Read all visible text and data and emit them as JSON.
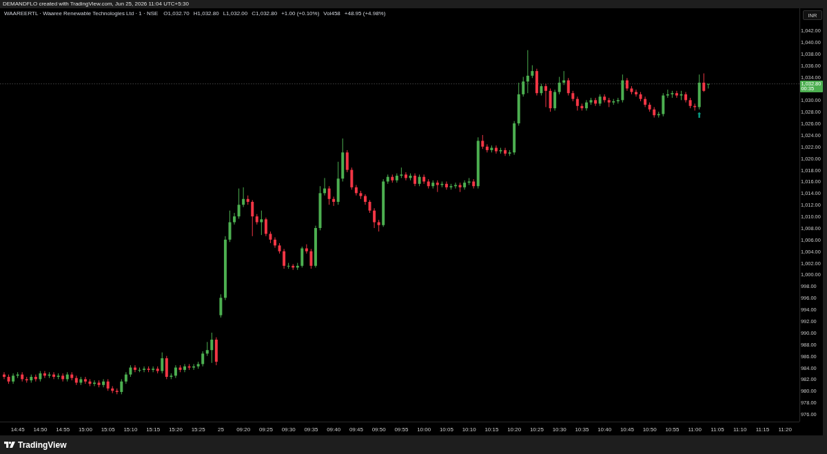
{
  "header": {
    "text": "DEMANDFLO created with TradingView.com, Jun 25, 2026 11:04 UTC+5:30"
  },
  "legend": {
    "symbol": "WAAREERTL · Waaree Renewable Technologies Ltd · 1 · NSE",
    "items": [
      "O1,032.70",
      "H1,032.80",
      "L1,032.00",
      "C1,032.80",
      "+1.00 (+0.10%)",
      "Vol458",
      "+48.95 (+4.98%)"
    ]
  },
  "currency_button": "INR",
  "price_tag": {
    "countdown": "00:35"
  },
  "chart_data": {
    "type": "candlestick",
    "ylim": [
      974.7,
      1045.8
    ],
    "ref_lines": [
      {
        "axis": "y",
        "value": 1032.8,
        "label": "1,032.80"
      }
    ],
    "annotations": [
      "⬆"
    ],
    "categories": [
      null,
      null,
      null,
      "14:45",
      null,
      null,
      null,
      null,
      "14:50",
      null,
      null,
      null,
      null,
      "14:55",
      null,
      null,
      null,
      null,
      "15:00",
      null,
      null,
      null,
      null,
      "15:05",
      null,
      null,
      null,
      null,
      "15:10",
      null,
      null,
      null,
      null,
      "15:15",
      null,
      null,
      null,
      null,
      "15:20",
      null,
      null,
      null,
      null,
      "15:25",
      null,
      null,
      null,
      null,
      "25",
      null,
      null,
      null,
      null,
      "09:20",
      null,
      null,
      null,
      null,
      "09:25",
      null,
      null,
      null,
      null,
      "09:30",
      null,
      null,
      null,
      null,
      "09:35",
      null,
      null,
      null,
      null,
      "09:40",
      null,
      null,
      null,
      null,
      "09:45",
      null,
      null,
      null,
      null,
      "09:50",
      null,
      null,
      null,
      null,
      "09:55",
      null,
      null,
      null,
      null,
      "10:00",
      null,
      null,
      null,
      null,
      "10:05",
      null,
      null,
      null,
      null,
      "10:10",
      null,
      null,
      null,
      null,
      "10:15",
      null,
      null,
      null,
      null,
      "10:20",
      null,
      null,
      null,
      null,
      "10:25",
      null,
      null,
      null,
      null,
      "10:30",
      null,
      null,
      null,
      null,
      "10:35",
      null,
      null,
      null,
      null,
      "10:40",
      null,
      null,
      null,
      null,
      "10:45",
      null,
      null,
      null,
      null,
      "10:50",
      null,
      null,
      null,
      null,
      "10:55",
      null,
      null,
      null,
      null,
      "11:00",
      null,
      null,
      null,
      null,
      "11:05",
      null,
      null,
      null,
      null,
      "11:10",
      null,
      null,
      null,
      null,
      "11:15",
      null,
      null,
      null,
      null,
      "11:20",
      null,
      null
    ],
    "ohlc": [
      [
        982.8,
        983.2,
        982.0,
        982.4
      ],
      [
        982.4,
        982.8,
        981.2,
        981.6
      ],
      [
        981.6,
        983.0,
        981.2,
        982.6
      ],
      [
        982.6,
        983.2,
        982.2,
        982.8
      ],
      [
        982.8,
        983.2,
        981.6,
        982.0
      ],
      [
        982.0,
        982.4,
        981.4,
        981.8
      ],
      [
        981.8,
        982.8,
        981.4,
        982.4
      ],
      [
        982.4,
        982.8,
        981.6,
        982.0
      ],
      [
        982.0,
        983.4,
        981.6,
        983.0
      ],
      [
        983.0,
        983.4,
        982.2,
        982.6
      ],
      [
        982.6,
        983.2,
        982.2,
        982.8
      ],
      [
        982.8,
        983.2,
        982.0,
        982.4
      ],
      [
        982.4,
        983.0,
        982.0,
        982.6
      ],
      [
        982.6,
        983.0,
        981.6,
        982.0
      ],
      [
        982.0,
        983.2,
        981.6,
        982.8
      ],
      [
        982.8,
        983.2,
        981.8,
        982.2
      ],
      [
        982.2,
        982.6,
        981.0,
        981.4
      ],
      [
        981.4,
        982.4,
        981.0,
        982.0
      ],
      [
        982.0,
        982.4,
        981.2,
        981.6
      ],
      [
        981.6,
        982.0,
        980.8,
        981.2
      ],
      [
        981.2,
        981.8,
        980.8,
        981.4
      ],
      [
        981.4,
        981.8,
        980.6,
        981.0
      ],
      [
        981.0,
        982.0,
        980.6,
        981.6
      ],
      [
        981.6,
        982.0,
        980.0,
        980.4
      ],
      [
        980.4,
        980.8,
        979.6,
        980.0
      ],
      [
        980.0,
        980.4,
        979.4,
        979.8
      ],
      [
        979.8,
        982.0,
        979.4,
        981.6
      ],
      [
        981.6,
        983.2,
        981.2,
        982.8
      ],
      [
        982.8,
        984.4,
        982.4,
        984.0
      ],
      [
        984.0,
        984.4,
        983.2,
        983.6
      ],
      [
        983.6,
        984.0,
        983.2,
        983.6
      ],
      [
        983.6,
        984.2,
        983.2,
        983.8
      ],
      [
        983.8,
        984.2,
        983.2,
        983.6
      ],
      [
        983.6,
        984.2,
        983.2,
        983.8
      ],
      [
        983.8,
        984.2,
        983.0,
        983.4
      ],
      [
        983.4,
        986.6,
        983.0,
        985.6
      ],
      [
        985.6,
        986.0,
        982.0,
        982.4
      ],
      [
        982.4,
        983.0,
        982.0,
        982.6
      ],
      [
        982.6,
        984.4,
        982.2,
        984.0
      ],
      [
        984.0,
        984.4,
        983.2,
        983.6
      ],
      [
        983.6,
        984.6,
        983.2,
        984.2
      ],
      [
        984.2,
        984.6,
        983.6,
        984.0
      ],
      [
        984.0,
        984.6,
        983.6,
        984.2
      ],
      [
        984.2,
        985.0,
        983.8,
        984.6
      ],
      [
        984.6,
        986.8,
        984.2,
        986.4
      ],
      [
        986.4,
        988.4,
        986.0,
        987.0
      ],
      [
        987.0,
        990.0,
        984.8,
        988.8
      ],
      [
        988.8,
        989.2,
        984.4,
        985.0
      ],
      [
        993.0,
        996.6,
        992.6,
        996.0
      ],
      [
        996.0,
        1006.6,
        995.6,
        1006.0
      ],
      [
        1006.0,
        1011.0,
        1005.6,
        1009.0
      ],
      [
        1009.0,
        1010.6,
        1008.6,
        1010.0
      ],
      [
        1010.0,
        1014.8,
        1009.6,
        1012.0
      ],
      [
        1012.0,
        1015.0,
        1011.6,
        1013.0
      ],
      [
        1013.0,
        1013.6,
        1012.0,
        1012.5
      ],
      [
        1012.5,
        1012.8,
        1006.6,
        1010.0
      ],
      [
        1010.0,
        1010.4,
        1008.6,
        1009.0
      ],
      [
        1009.0,
        1011.0,
        1006.8,
        1009.5
      ],
      [
        1009.5,
        1009.8,
        1006.6,
        1007.0
      ],
      [
        1007.0,
        1007.4,
        1005.4,
        1006.0
      ],
      [
        1006.0,
        1006.4,
        1004.6,
        1005.0
      ],
      [
        1005.0,
        1005.4,
        1003.6,
        1004.0
      ],
      [
        1004.0,
        1004.4,
        1001.0,
        1001.5
      ],
      [
        1001.5,
        1002.0,
        1001.0,
        1001.5
      ],
      [
        1001.5,
        1001.8,
        1000.8,
        1001.2
      ],
      [
        1001.2,
        1002.0,
        1000.8,
        1001.5
      ],
      [
        1001.5,
        1004.8,
        1001.2,
        1004.5
      ],
      [
        1004.5,
        1005.2,
        1003.6,
        1004.0
      ],
      [
        1004.0,
        1004.4,
        1001.0,
        1001.5
      ],
      [
        1001.5,
        1008.4,
        1001.2,
        1008.0
      ],
      [
        1008.0,
        1015.2,
        1007.6,
        1014.0
      ],
      [
        1014.0,
        1016.6,
        1013.6,
        1014.8
      ],
      [
        1014.8,
        1015.2,
        1012.0,
        1013.0
      ],
      [
        1013.0,
        1013.4,
        1011.8,
        1012.5
      ],
      [
        1012.5,
        1019.4,
        1012.0,
        1016.5
      ],
      [
        1016.5,
        1023.4,
        1016.0,
        1021.0
      ],
      [
        1021.0,
        1021.4,
        1017.6,
        1018.0
      ],
      [
        1018.0,
        1018.4,
        1014.6,
        1015.0
      ],
      [
        1015.0,
        1015.4,
        1013.6,
        1014.0
      ],
      [
        1014.0,
        1014.4,
        1013.0,
        1013.5
      ],
      [
        1013.5,
        1013.8,
        1012.0,
        1012.5
      ],
      [
        1012.5,
        1012.8,
        1010.6,
        1011.0
      ],
      [
        1011.0,
        1011.4,
        1008.0,
        1009.0
      ],
      [
        1009.0,
        1009.4,
        1007.4,
        1008.5
      ],
      [
        1008.5,
        1016.4,
        1008.2,
        1016.0
      ],
      [
        1016.0,
        1017.2,
        1015.6,
        1016.8
      ],
      [
        1016.8,
        1017.2,
        1015.8,
        1016.2
      ],
      [
        1016.2,
        1017.4,
        1015.8,
        1017.0
      ],
      [
        1017.0,
        1018.4,
        1016.6,
        1017.2
      ],
      [
        1017.2,
        1017.6,
        1016.2,
        1016.6
      ],
      [
        1016.6,
        1017.4,
        1016.2,
        1017.0
      ],
      [
        1017.0,
        1017.4,
        1015.2,
        1015.6
      ],
      [
        1015.6,
        1017.2,
        1015.2,
        1016.8
      ],
      [
        1016.8,
        1017.2,
        1015.6,
        1016.0
      ],
      [
        1016.0,
        1016.4,
        1014.8,
        1015.2
      ],
      [
        1015.2,
        1016.2,
        1014.8,
        1015.8
      ],
      [
        1015.8,
        1016.2,
        1014.2,
        1015.4
      ],
      [
        1015.4,
        1016.0,
        1015.0,
        1015.6
      ],
      [
        1015.6,
        1016.0,
        1014.6,
        1015.0
      ],
      [
        1015.0,
        1015.6,
        1014.6,
        1015.2
      ],
      [
        1015.2,
        1015.8,
        1014.8,
        1015.4
      ],
      [
        1015.4,
        1015.8,
        1014.2,
        1015.0
      ],
      [
        1015.0,
        1016.2,
        1014.6,
        1015.8
      ],
      [
        1015.8,
        1016.6,
        1015.4,
        1016.0
      ],
      [
        1016.0,
        1016.4,
        1014.8,
        1015.2
      ],
      [
        1015.2,
        1023.6,
        1014.8,
        1023.0
      ],
      [
        1023.0,
        1024.0,
        1021.6,
        1022.0
      ],
      [
        1022.0,
        1022.4,
        1021.0,
        1021.4
      ],
      [
        1021.4,
        1022.2,
        1021.0,
        1021.8
      ],
      [
        1021.8,
        1022.2,
        1020.8,
        1021.2
      ],
      [
        1021.2,
        1021.8,
        1020.8,
        1021.4
      ],
      [
        1021.4,
        1021.8,
        1020.4,
        1020.8
      ],
      [
        1020.8,
        1021.4,
        1020.4,
        1021.0
      ],
      [
        1021.0,
        1026.4,
        1020.6,
        1026.0
      ],
      [
        1026.0,
        1033.0,
        1025.6,
        1031.0
      ],
      [
        1031.0,
        1034.0,
        1030.6,
        1033.2
      ],
      [
        1033.2,
        1038.6,
        1031.2,
        1034.2
      ],
      [
        1034.2,
        1036.0,
        1033.8,
        1035.0
      ],
      [
        1035.0,
        1035.4,
        1030.8,
        1031.2
      ],
      [
        1031.2,
        1032.8,
        1030.8,
        1032.4
      ],
      [
        1032.4,
        1032.8,
        1028.8,
        1031.6
      ],
      [
        1031.6,
        1032.0,
        1028.0,
        1028.6
      ],
      [
        1028.6,
        1031.8,
        1028.2,
        1031.4
      ],
      [
        1031.4,
        1034.0,
        1031.0,
        1033.0
      ],
      [
        1033.0,
        1035.0,
        1032.6,
        1033.4
      ],
      [
        1033.4,
        1033.8,
        1030.8,
        1031.2
      ],
      [
        1031.2,
        1031.6,
        1029.8,
        1030.2
      ],
      [
        1030.2,
        1030.6,
        1028.2,
        1029.0
      ],
      [
        1029.0,
        1029.4,
        1028.2,
        1028.6
      ],
      [
        1028.6,
        1030.0,
        1028.2,
        1029.6
      ],
      [
        1029.6,
        1030.4,
        1029.2,
        1030.0
      ],
      [
        1030.0,
        1030.4,
        1029.0,
        1029.4
      ],
      [
        1029.4,
        1031.0,
        1029.0,
        1030.6
      ],
      [
        1030.6,
        1031.0,
        1029.6,
        1030.0
      ],
      [
        1030.0,
        1030.4,
        1028.8,
        1029.6
      ],
      [
        1029.6,
        1030.2,
        1029.2,
        1029.8
      ],
      [
        1029.8,
        1030.4,
        1029.4,
        1030.0
      ],
      [
        1030.0,
        1034.4,
        1029.6,
        1033.4
      ],
      [
        1033.4,
        1033.8,
        1031.6,
        1032.0
      ],
      [
        1032.0,
        1032.4,
        1031.0,
        1031.4
      ],
      [
        1031.4,
        1031.8,
        1030.6,
        1031.0
      ],
      [
        1031.0,
        1031.4,
        1029.8,
        1030.2
      ],
      [
        1030.2,
        1030.6,
        1028.8,
        1029.2
      ],
      [
        1029.2,
        1029.6,
        1028.0,
        1028.4
      ],
      [
        1028.4,
        1028.8,
        1027.0,
        1027.4
      ],
      [
        1027.4,
        1028.0,
        1027.0,
        1027.6
      ],
      [
        1027.6,
        1031.2,
        1027.2,
        1030.8
      ],
      [
        1030.8,
        1031.8,
        1030.4,
        1031.0
      ],
      [
        1031.0,
        1031.6,
        1030.4,
        1031.2
      ],
      [
        1031.2,
        1031.6,
        1030.4,
        1030.8
      ],
      [
        1030.8,
        1031.6,
        1030.0,
        1031.0
      ],
      [
        1031.0,
        1031.4,
        1029.6,
        1030.0
      ],
      [
        1030.0,
        1030.4,
        1028.6,
        1029.0
      ],
      [
        1029.0,
        1029.4,
        1028.2,
        1028.8
      ],
      [
        1028.8,
        1034.4,
        1028.4,
        1033.0
      ],
      [
        1033.0,
        1034.6,
        1031.4,
        1031.6
      ],
      [
        1032.7,
        1032.8,
        1032.0,
        1032.8
      ],
      null,
      null,
      null,
      null,
      null,
      null,
      null,
      null,
      null,
      null,
      null,
      null,
      null,
      null,
      null,
      null,
      null,
      null,
      null
    ],
    "yticks": [
      {
        "value": 1042,
        "label": "1,042.00"
      },
      {
        "value": 1040,
        "label": "1,040.00"
      },
      {
        "value": 1038,
        "label": "1,038.00"
      },
      {
        "value": 1036,
        "label": "1,036.00"
      },
      {
        "value": 1034,
        "label": "1,034.00"
      },
      {
        "value": 1030,
        "label": "1,030.00"
      },
      {
        "value": 1028,
        "label": "1,028.00"
      },
      {
        "value": 1026,
        "label": "1,026.00"
      },
      {
        "value": 1024,
        "label": "1,024.00"
      },
      {
        "value": 1022,
        "label": "1,022.00"
      },
      {
        "value": 1020,
        "label": "1,020.00"
      },
      {
        "value": 1018,
        "label": "1,018.00"
      },
      {
        "value": 1016,
        "label": "1,016.00"
      },
      {
        "value": 1014,
        "label": "1,014.00"
      },
      {
        "value": 1012,
        "label": "1,012.00"
      },
      {
        "value": 1010,
        "label": "1,010.00"
      },
      {
        "value": 1008,
        "label": "1,008.00"
      },
      {
        "value": 1006,
        "label": "1,006.00"
      },
      {
        "value": 1004,
        "label": "1,004.00"
      },
      {
        "value": 1002,
        "label": "1,002.00"
      },
      {
        "value": 1000,
        "label": "1,000.00"
      },
      {
        "value": 998,
        "label": "998.00"
      },
      {
        "value": 996,
        "label": "996.00"
      },
      {
        "value": 994,
        "label": "994.00"
      },
      {
        "value": 992,
        "label": "992.00"
      },
      {
        "value": 990,
        "label": "990.00"
      },
      {
        "value": 988,
        "label": "988.00"
      },
      {
        "value": 986,
        "label": "986.00"
      },
      {
        "value": 984,
        "label": "984.00"
      },
      {
        "value": 982,
        "label": "982.00"
      },
      {
        "value": 980,
        "label": "980.00"
      },
      {
        "value": 978,
        "label": "978.00"
      },
      {
        "value": 976,
        "label": "976.00"
      }
    ]
  },
  "footer": {
    "brand": "TradingView"
  }
}
